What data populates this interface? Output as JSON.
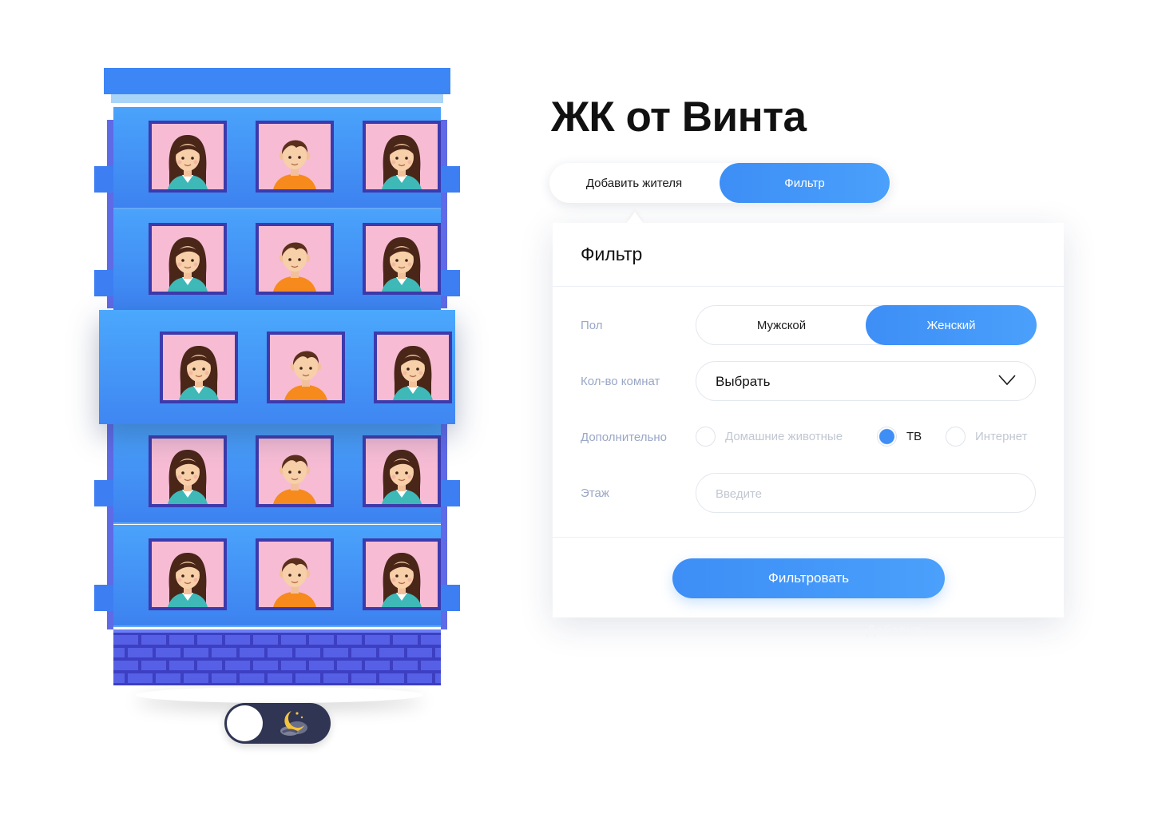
{
  "page": {
    "title": "ЖК от Винта"
  },
  "tabs": {
    "add_resident": "Добавить жителя",
    "filter": "Фильтр"
  },
  "filter_panel": {
    "title": "Фильтр",
    "gender": {
      "label": "Пол",
      "options": [
        "Мужской",
        "Женский"
      ],
      "selected": "Женский"
    },
    "rooms": {
      "label": "Кол-во комнат",
      "value": "Выбрать"
    },
    "extras": {
      "label": "Дополнительно",
      "options": [
        {
          "label": "Домашние животные",
          "checked": false
        },
        {
          "label": "ТВ",
          "checked": true
        },
        {
          "label": "Интернет",
          "checked": false
        }
      ]
    },
    "floor": {
      "label": "Этаж",
      "placeholder": "Введите"
    },
    "submit_label": "Фильтровать"
  },
  "ghost_label": "Добавить",
  "building": {
    "floors": [
      [
        "female-resident",
        "male-resident",
        "female-resident"
      ],
      [
        "female-resident",
        "male-resident",
        "female-resident"
      ],
      [
        "female-resident",
        "male-resident",
        "female-resident"
      ],
      [
        "female-resident",
        "male-resident",
        "female-resident"
      ],
      [
        "female-resident",
        "male-resident",
        "female-resident"
      ]
    ],
    "highlighted_floor": 3
  },
  "theme_toggle": {
    "icon": "moon-icon",
    "state": "day"
  },
  "colors": {
    "accent": "#3d8ef6",
    "building": "#4aa3fb",
    "window_frame": "#3c3aac",
    "window_bg": "#f7bcd4",
    "label": "#9aa7c6"
  }
}
